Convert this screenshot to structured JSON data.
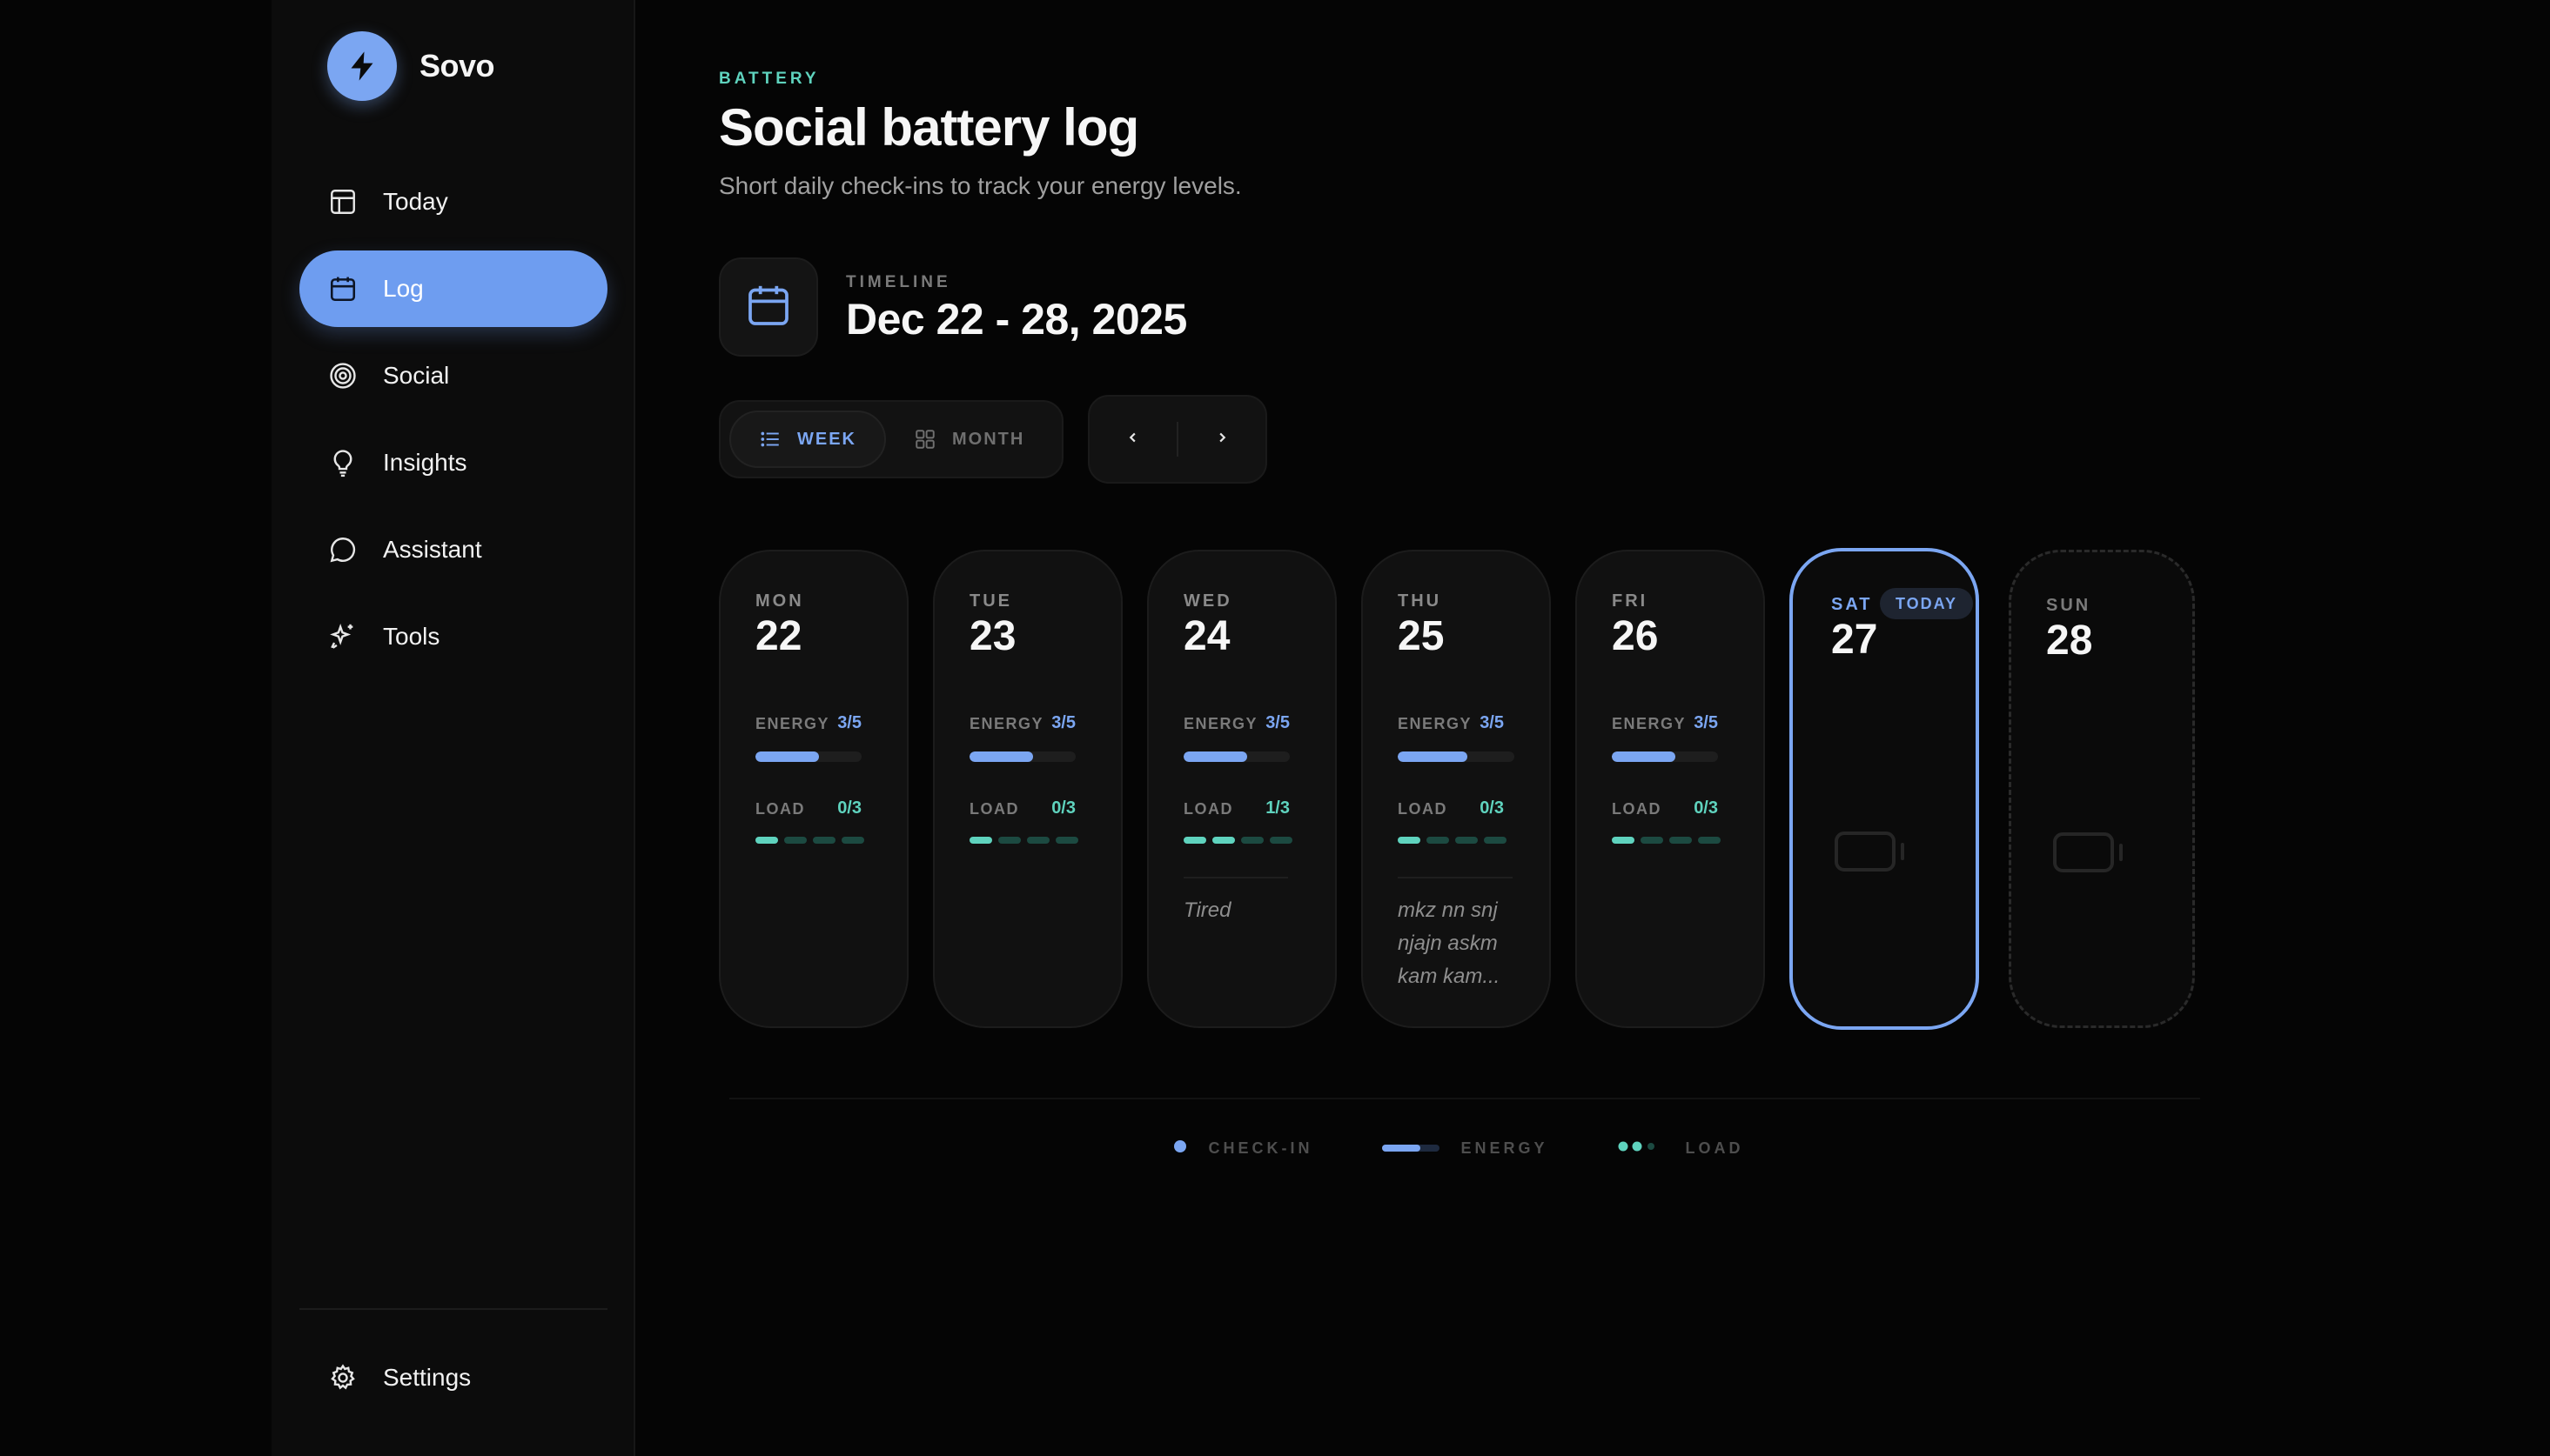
{
  "brand": {
    "name": "Sovo"
  },
  "sidebar": {
    "items": [
      {
        "label": "Today",
        "icon": "layout-icon",
        "active": false
      },
      {
        "label": "Log",
        "icon": "calendar-icon",
        "active": true
      },
      {
        "label": "Social",
        "icon": "target-icon",
        "active": false
      },
      {
        "label": "Insights",
        "icon": "lightbulb-icon",
        "active": false
      },
      {
        "label": "Assistant",
        "icon": "chat-bubble-icon",
        "active": false
      },
      {
        "label": "Tools",
        "icon": "sparkles-icon",
        "active": false
      }
    ],
    "settings_label": "Settings"
  },
  "header": {
    "eyebrow": "BATTERY",
    "title": "Social battery log",
    "subtitle": "Short daily check-ins to track your energy levels."
  },
  "timeline": {
    "label": "TIMELINE",
    "range": "Dec 22 - 28, 2025"
  },
  "view_toggle": {
    "week_label": "WEEK",
    "month_label": "MONTH",
    "selected": "WEEK"
  },
  "pager": {
    "prev": "‹",
    "next": "›"
  },
  "stat_labels": {
    "energy": "ENERGY",
    "load": "LOAD"
  },
  "days": [
    {
      "dow": "MON",
      "num": "22",
      "energy": "3/5",
      "energy_frac": 0.6,
      "load": "0/3",
      "load_level": 1,
      "note": ""
    },
    {
      "dow": "TUE",
      "num": "23",
      "energy": "3/5",
      "energy_frac": 0.6,
      "load": "0/3",
      "load_level": 1,
      "note": ""
    },
    {
      "dow": "WED",
      "num": "24",
      "energy": "3/5",
      "energy_frac": 0.6,
      "load": "1/3",
      "load_level": 2,
      "note": "Tired"
    },
    {
      "dow": "THU",
      "num": "25",
      "energy": "3/5",
      "energy_frac": 0.6,
      "load": "0/3",
      "load_level": 1,
      "note": "mkz nn snj njajn askm kam kam..."
    },
    {
      "dow": "FRI",
      "num": "26",
      "energy": "3/5",
      "energy_frac": 0.6,
      "load": "0/3",
      "load_level": 1,
      "note": ""
    }
  ],
  "today_day": {
    "dow": "SAT",
    "num": "27",
    "badge": "TODAY"
  },
  "future_day": {
    "dow": "SUN",
    "num": "28"
  },
  "legend": {
    "checkin": "CHECK-IN",
    "energy": "ENERGY",
    "load": "LOAD"
  },
  "colors": {
    "accent": "#7ba6f2",
    "teal": "#5fd3be",
    "bg": "#050505"
  }
}
